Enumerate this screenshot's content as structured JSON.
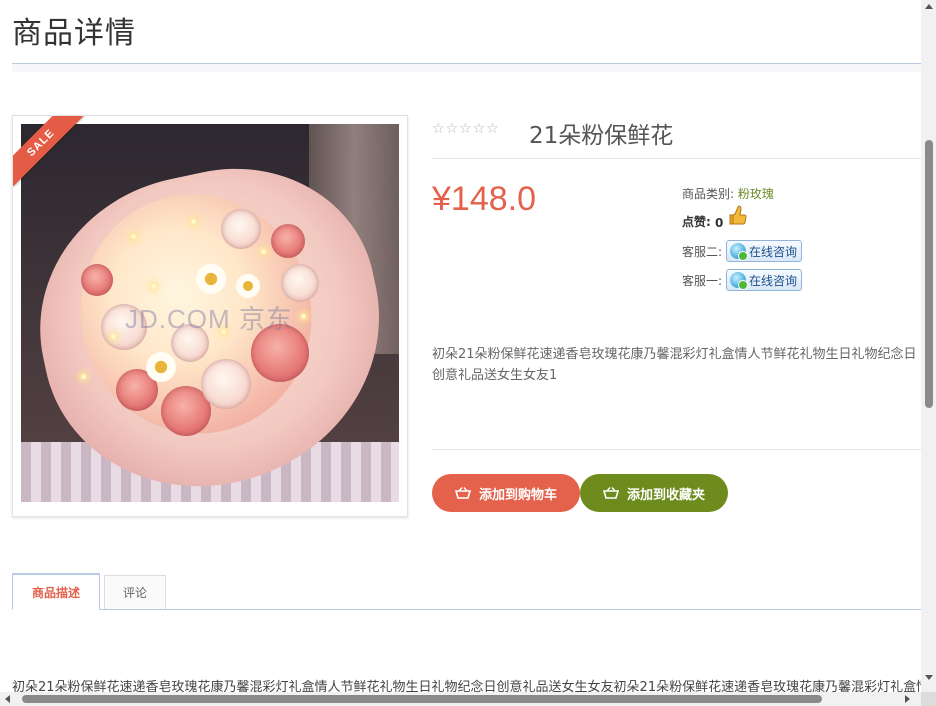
{
  "page": {
    "title": "商品详情"
  },
  "product": {
    "sale_badge": "SALE",
    "image_watermark": "JD.COM 京东",
    "name": "21朵粉保鲜花",
    "rating_stars": "☆☆☆☆☆",
    "price": "¥148.0",
    "category_label": "商品类别:",
    "category_value": "粉玫瑰",
    "likes_label": "点赞:",
    "likes_value": "0",
    "service2_label": "客服二:",
    "service1_label": "客服一:",
    "chat_label": "在线咨询",
    "description": "初朵21朵粉保鲜花速递香皂玫瑰花康乃馨混彩灯礼盒情人节鲜花礼物生日礼物纪念日创意礼品送女生女友1"
  },
  "actions": {
    "add_to_cart": "添加到购物车",
    "add_to_favorites": "添加到收藏夹"
  },
  "colors": {
    "accent": "#e4624b",
    "secondary": "#6e8c1e"
  },
  "tabs": [
    {
      "label": "商品描述",
      "active": true
    },
    {
      "label": "评论",
      "active": false
    }
  ],
  "detail_text": "初朵21朵粉保鲜花速递香皂玫瑰花康乃馨混彩灯礼盒情人节鲜花礼物生日礼物纪念日创意礼品送女生女友初朵21朵粉保鲜花速递香皂玫瑰花康乃馨混彩灯礼盒情"
}
